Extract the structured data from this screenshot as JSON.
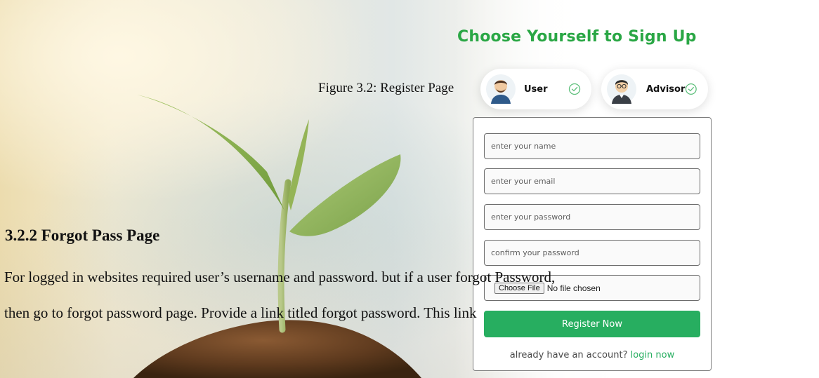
{
  "signup": {
    "title": "Choose Yourself to Sign Up",
    "roles": [
      {
        "label": "User",
        "selected": true
      },
      {
        "label": "Advisor",
        "selected": true
      }
    ],
    "accent_color": "#27ae60",
    "icons": {
      "user_avatar": "user-avatar-icon",
      "advisor_avatar": "advisor-avatar-icon",
      "check": "check-circle-icon"
    }
  },
  "form": {
    "name_placeholder": "enter your name",
    "email_placeholder": "enter your email",
    "password_placeholder": "enter your password",
    "confirm_placeholder": "confirm your password",
    "file_button": "Choose File",
    "file_status": "No file chosen",
    "submit_label": "Register Now",
    "login_prompt": "already have an account?",
    "login_link": "login now"
  },
  "document": {
    "caption": "Figure 3.2: Register Page",
    "section_heading": "3.2.2 Forgot Pass Page",
    "paragraph_line_1": "For logged in websites required user’s username and password. but if a user forgot Password,",
    "paragraph_line_2": "then go to forgot password page. Provide a link titled forgot password. This link"
  }
}
